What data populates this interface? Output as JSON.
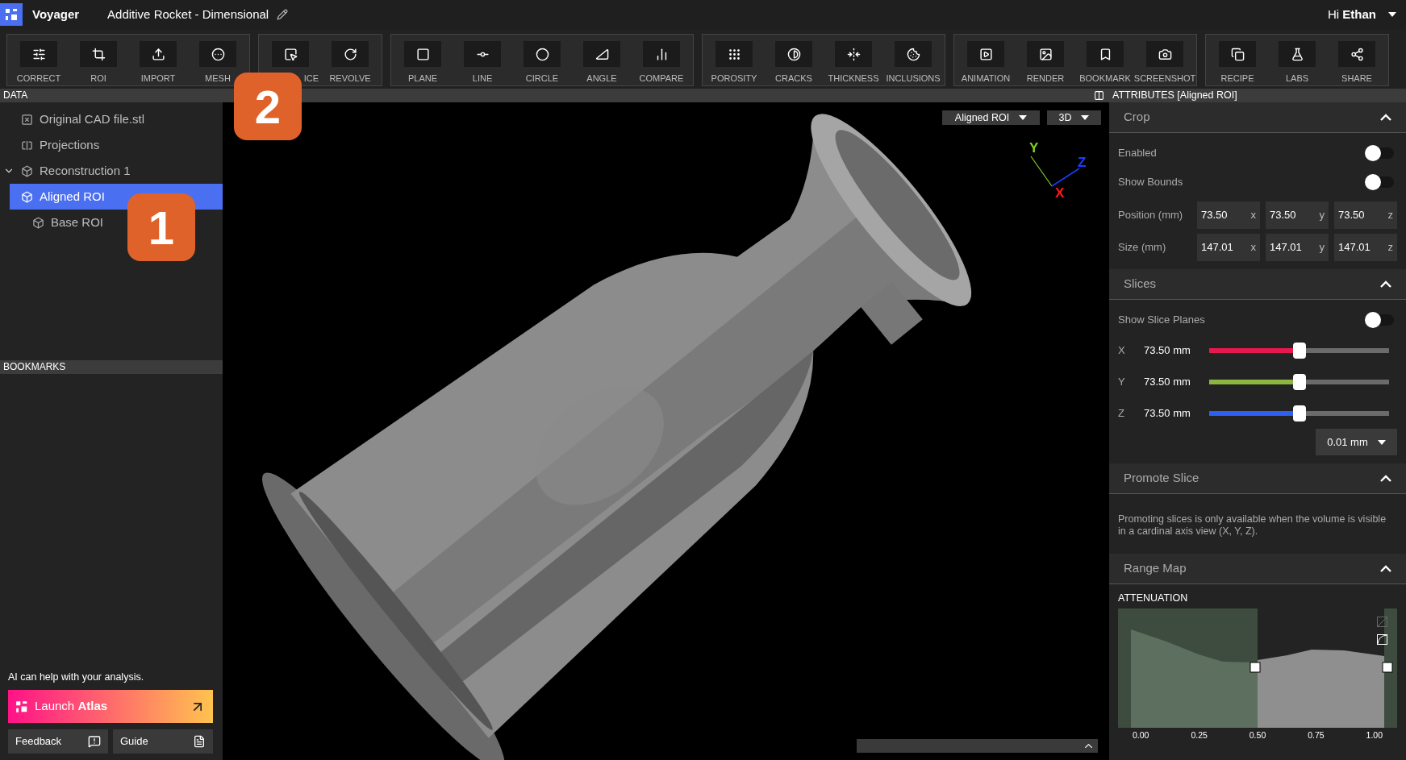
{
  "header": {
    "app_name": "Voyager",
    "project_title": "Additive Rocket - Dimensional",
    "greeting": "Hi",
    "user": "Ethan"
  },
  "toolbar_groups": [
    {
      "tools": [
        {
          "label": "CORRECT"
        },
        {
          "label": "ROI"
        },
        {
          "label": "IMPORT"
        },
        {
          "label": "MESH"
        }
      ]
    },
    {
      "tools": [
        {
          "label": "ICE"
        },
        {
          "label": "REVOLVE"
        }
      ]
    },
    {
      "tools": [
        {
          "label": "PLANE"
        },
        {
          "label": "LINE"
        },
        {
          "label": "CIRCLE"
        },
        {
          "label": "ANGLE"
        },
        {
          "label": "COMPARE"
        }
      ]
    },
    {
      "tools": [
        {
          "label": "POROSITY"
        },
        {
          "label": "CRACKS"
        },
        {
          "label": "THICKNESS"
        },
        {
          "label": "INCLUSIONS"
        }
      ]
    },
    {
      "tools": [
        {
          "label": "ANIMATION"
        },
        {
          "label": "RENDER"
        },
        {
          "label": "BOOKMARK"
        },
        {
          "label": "SCREENSHOT"
        }
      ]
    },
    {
      "tools": [
        {
          "label": "RECIPE"
        },
        {
          "label": "LABS"
        },
        {
          "label": "SHARE"
        }
      ]
    }
  ],
  "data_panel": {
    "title": "DATA",
    "items": [
      {
        "label": "Original CAD file.stl",
        "kind": "cad",
        "selected": false
      },
      {
        "label": "Projections",
        "kind": "projections",
        "selected": false
      },
      {
        "label": "Reconstruction 1",
        "kind": "volume",
        "selected": false,
        "expanded": true,
        "children": [
          {
            "label": "Aligned ROI",
            "kind": "volume",
            "selected": true
          },
          {
            "label": "Base ROI",
            "kind": "volume",
            "selected": false
          }
        ]
      }
    ]
  },
  "bookmarks_panel": {
    "title": "BOOKMARKS"
  },
  "assistant": {
    "prompt": "AI can help with your analysis.",
    "button": "Launch **Atlas**"
  },
  "footer_buttons": [
    {
      "label": "Feedback",
      "kind": "feedback"
    },
    {
      "label": "Guide",
      "kind": "guide"
    }
  ],
  "callouts": [
    {
      "number": "1"
    },
    {
      "number": "2"
    }
  ],
  "viewport": {
    "dropdowns": [
      "Aligned ROI",
      "3D"
    ],
    "axes": [
      {
        "label": "Y",
        "color": "#7ed321"
      },
      {
        "label": "X",
        "color": "#ff1a1a"
      },
      {
        "label": "Z",
        "color": "#1a3cff"
      }
    ]
  },
  "attributes": {
    "title": "ATTRIBUTES [Aligned ROI]",
    "sections": [
      {
        "title": "Crop",
        "kind": "crop",
        "expanded": true,
        "toggles": [
          {
            "label": "Enabled",
            "on": false
          },
          {
            "label": "Show Bounds",
            "on": false
          }
        ],
        "vectors": [
          {
            "label": "Position (mm)",
            "fields": [
              {
                "value": "73.50",
                "axis": "x"
              },
              {
                "value": "73.50",
                "axis": "y"
              },
              {
                "value": "73.50",
                "axis": "z"
              }
            ]
          },
          {
            "label": "Size (mm)",
            "fields": [
              {
                "value": "147.01",
                "axis": "x"
              },
              {
                "value": "147.01",
                "axis": "y"
              },
              {
                "value": "147.01",
                "axis": "z"
              }
            ]
          }
        ]
      },
      {
        "title": "Slices",
        "kind": "slices",
        "expanded": true,
        "toggles": [
          {
            "label": "Show Slice Planes",
            "on": false
          }
        ],
        "sliders": [
          {
            "axis": "X",
            "reading": "73.50 mm",
            "level": 0.5,
            "color": "#e8184f"
          },
          {
            "axis": "Y",
            "reading": "73.50 mm",
            "level": 0.5,
            "color": "#8db542"
          },
          {
            "axis": "Z",
            "reading": "73.50 mm",
            "level": 0.5,
            "color": "#2f5ff0"
          }
        ],
        "step": "0.01 mm"
      },
      {
        "title": "Promote Slice",
        "kind": "note",
        "expanded": true,
        "text": "Promoting slices is only available when the volume is visible in a cardinal axis view (X, Y, Z)."
      },
      {
        "title": "Range Map",
        "kind": "range_map",
        "expanded": true,
        "label": "ATTENUATION",
        "ticks": [
          "0.00",
          "0.25",
          "0.50",
          "0.75",
          "1.00"
        ]
      }
    ]
  }
}
